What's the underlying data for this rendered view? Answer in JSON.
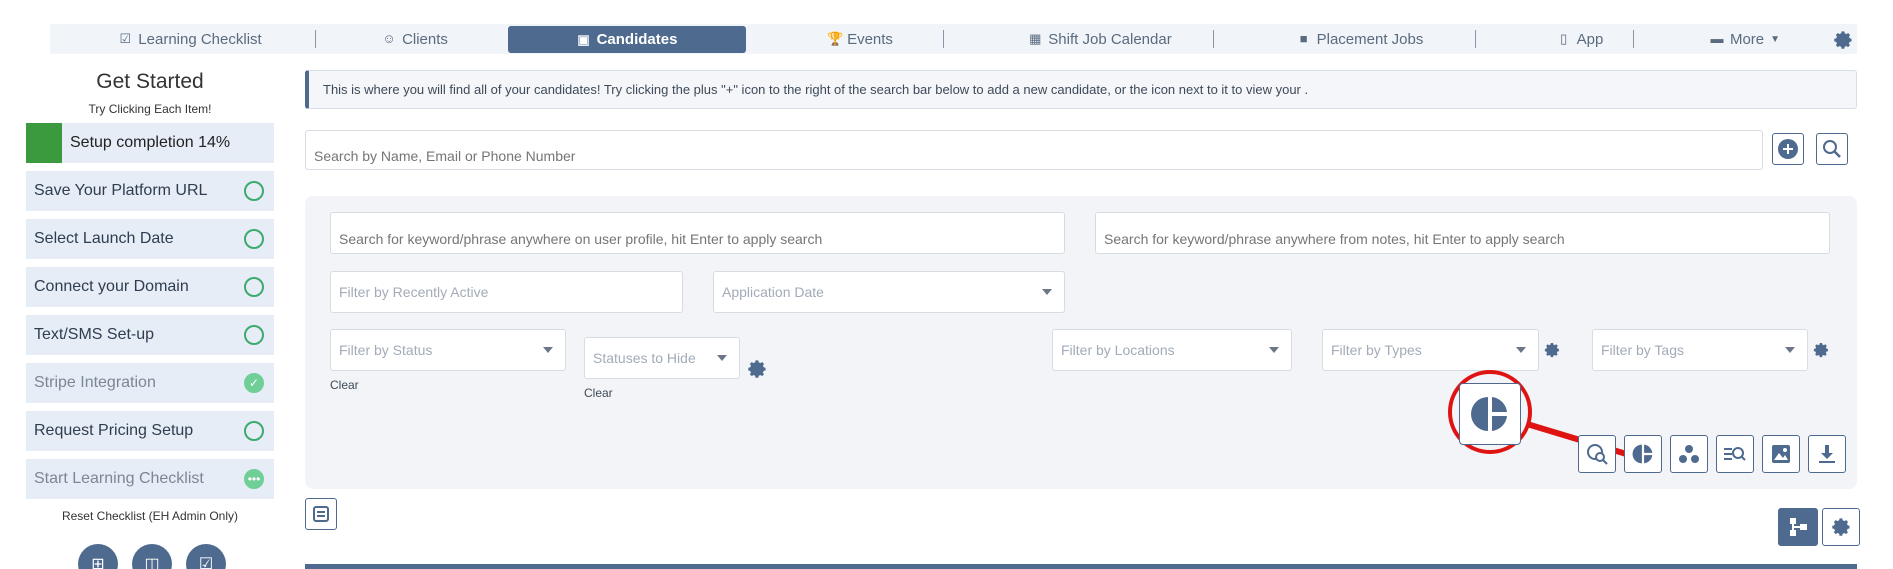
{
  "nav": {
    "items": [
      {
        "label": "Learning Checklist",
        "icon": "checklist-icon"
      },
      {
        "label": "Clients",
        "icon": "clients-icon"
      },
      {
        "label": "Candidates",
        "icon": "candidates-icon",
        "active": true
      },
      {
        "label": "Events",
        "icon": "trophy-icon"
      },
      {
        "label": "Shift Job Calendar",
        "icon": "calendar-icon"
      },
      {
        "label": "Placement Jobs",
        "icon": "briefcase-icon"
      },
      {
        "label": "App",
        "icon": "phone-icon"
      },
      {
        "label": "More",
        "icon": "more-icon"
      }
    ]
  },
  "sidebar": {
    "title": "Get Started",
    "subtitle": "Try Clicking Each Item!",
    "progress_label": "Setup completion 14%",
    "progress_fraction": 0.14,
    "items": [
      {
        "label": "Save Your Platform URL",
        "status": "open"
      },
      {
        "label": "Select Launch Date",
        "status": "open"
      },
      {
        "label": "Connect your Domain",
        "status": "open"
      },
      {
        "label": "Text/SMS Set-up",
        "status": "open"
      },
      {
        "label": "Stripe Integration",
        "status": "done"
      },
      {
        "label": "Request Pricing Setup",
        "status": "open"
      },
      {
        "label": "Start Learning Checklist",
        "status": "in-progress"
      }
    ],
    "reset_label": "Reset Checklist (EH Admin Only)"
  },
  "main": {
    "banner": "This is where you will find all of your candidates! Try clicking the plus \"+\" icon to the right of the search bar below to add a new candidate, or the icon next to it to view your .",
    "search_placeholder": "Search by Name, Email or Phone Number",
    "filters": {
      "keyword_profile": "Search for keyword/phrase anywhere on user profile, hit Enter to apply search",
      "keyword_notes": "Search for keyword/phrase anywhere from notes, hit Enter to apply search",
      "recently_active": "Filter by Recently Active",
      "application_date": "Application Date",
      "status": "Filter by Status",
      "statuses_hide": "Statuses to Hide",
      "locations": "Filter by Locations",
      "types": "Filter by Types",
      "tags": "Filter by Tags",
      "clear": "Clear"
    }
  },
  "colors": {
    "primary": "#4e6a8e",
    "progress": "#3c9a3e",
    "callout": "#e01313"
  }
}
